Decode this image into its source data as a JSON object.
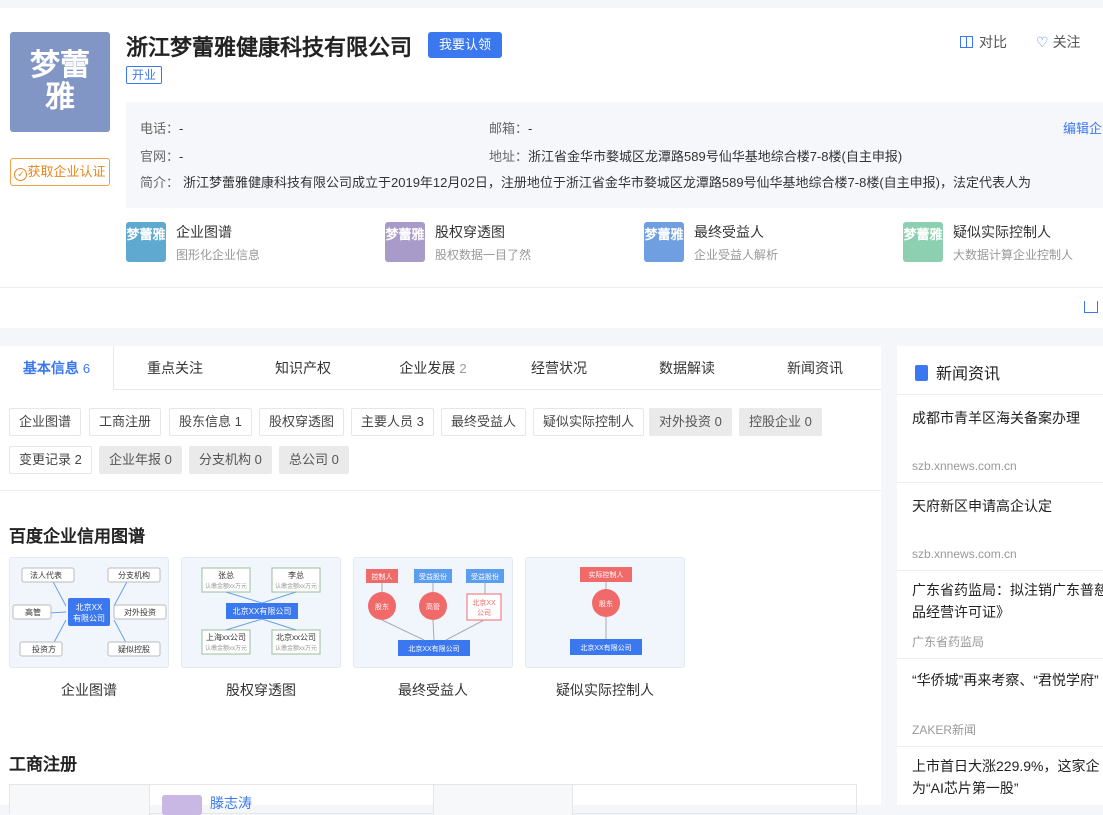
{
  "company": {
    "logo_text": "梦蕾雅",
    "name": "浙江梦蕾雅健康科技有限公司",
    "claim_label": "我要认领",
    "status": "开业",
    "cert_label": "获取企业认证",
    "compare_label": "对比",
    "follow_label": "关注"
  },
  "info": {
    "phone_label": "电话：",
    "phone": "-",
    "email_label": "邮箱：",
    "email": "-",
    "edit_label": "编辑企",
    "website_label": "官网：",
    "website": "-",
    "address_label": "地址：",
    "address": "浙江省金华市婺城区龙潭路589号仙华基地综合楼7-8楼(自主申报)",
    "intro_label": "简介：",
    "intro": "浙江梦蕾雅健康科技有限公司成立于2019年12月02日，注册地位于浙江省金华市婺城区龙潭路589号仙华基地综合楼7-8楼(自主申报)，法定代表人为"
  },
  "features": [
    {
      "icon_text": "梦蕾雅",
      "title": "企业图谱",
      "sub": "图形化企业信息",
      "color": "#5fa8cf"
    },
    {
      "icon_text": "梦蕾雅",
      "title": "股权穿透图",
      "sub": "股权数据一目了然",
      "color": "#a99bc9"
    },
    {
      "icon_text": "梦蕾雅",
      "title": "最终受益人",
      "sub": "企业受益人解析",
      "color": "#6f9fe0"
    },
    {
      "icon_text": "梦蕾雅",
      "title": "疑似实际控制人",
      "sub": "大数据计算企业控制人",
      "color": "#8dd0b1"
    }
  ],
  "tabs": [
    {
      "label": "基本信息",
      "count": "6"
    },
    {
      "label": "重点关注",
      "count": ""
    },
    {
      "label": "知识产权",
      "count": ""
    },
    {
      "label": "企业发展",
      "count": "2"
    },
    {
      "label": "经营状况",
      "count": ""
    },
    {
      "label": "数据解读",
      "count": ""
    },
    {
      "label": "新闻资讯",
      "count": ""
    }
  ],
  "tags_row1": [
    "企业图谱",
    "工商注册",
    "股东信息 1",
    "股权穿透图",
    "主要人员 3",
    "最终受益人",
    "疑似实际控制人",
    "对外投资 0",
    "控股企业 0"
  ],
  "tags_row2": [
    "变更记录 2",
    "企业年报 0",
    "分支机构 0",
    "总公司 0"
  ],
  "section_graph_title": "百度企业信用图谱",
  "graph_cards": [
    "企业图谱",
    "股权穿透图",
    "最终受益人",
    "疑似实际控制人"
  ],
  "diagram": {
    "legal_rep": "法人代表",
    "branches": "分支机构",
    "exec": "高管",
    "invest_out": "对外投资",
    "investor": "投资方",
    "suspect_ctrl": "疑似控股",
    "center_l1": "北京XX",
    "center_l2": "有限公司",
    "zhang": "张总",
    "li": "李总",
    "sub_amount": "认缴金额xx万元",
    "bj_company": "北京XX有限公司",
    "sh_company": "上海xx公司",
    "bj_company2": "北京xx公司",
    "controller": "控制人",
    "benefit_shares": "受益股份",
    "shareholder": "股东",
    "executive": "高管",
    "bj_xx": "北京XX",
    "company": "公司",
    "actual_controller": "实际控制人"
  },
  "section_reg_title": "工商注册",
  "reg_partial": "滕志涛",
  "news": {
    "header": "新闻资讯",
    "items": [
      {
        "title": "成都市青羊区海关备案办理",
        "title2": "",
        "source": "szb.xnnews.com.cn"
      },
      {
        "title": "天府新区申请高企认定",
        "title2": "",
        "source": "szb.xnnews.com.cn"
      },
      {
        "title": "广东省药监局：拟注销广东普慈",
        "title2": "品经营许可证》",
        "source": "广东省药监局"
      },
      {
        "title": "“华侨城”再来考察、“君悦学府”",
        "title2": "",
        "source": "ZAKER新闻"
      },
      {
        "title": "上市首日大涨229.9%，这家企",
        "title2": "为“AI芯片第一股”",
        "source": ""
      }
    ]
  }
}
